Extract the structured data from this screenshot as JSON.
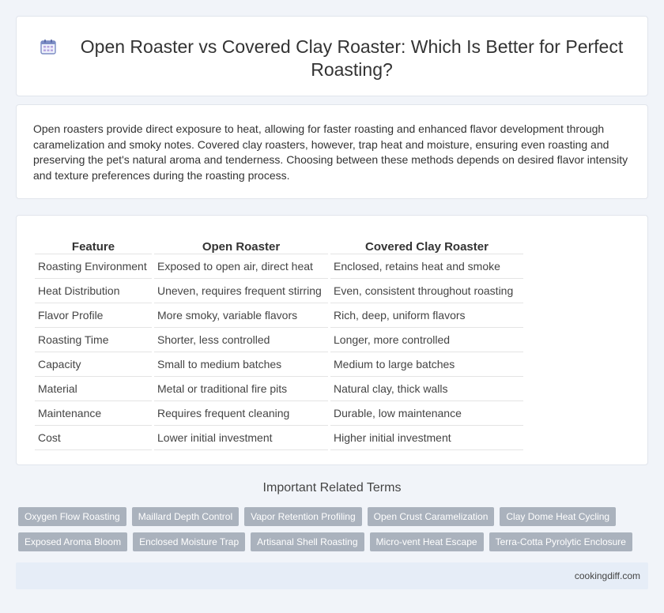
{
  "header": {
    "icon": "calendar-icon",
    "title": "Open Roaster vs Covered Clay Roaster: Which Is Better for Perfect Roasting?"
  },
  "intro": {
    "text": "Open roasters provide direct exposure to heat, allowing for faster roasting and enhanced flavor development through caramelization and smoky notes. Covered clay roasters, however, trap heat and moisture, ensuring even roasting and preserving the pet's natural aroma and tenderness. Choosing between these methods depends on desired flavor intensity and texture preferences during the roasting process."
  },
  "comparison": {
    "headers": [
      "Feature",
      "Open Roaster",
      "Covered Clay Roaster"
    ],
    "rows": [
      [
        "Roasting Environment",
        "Exposed to open air, direct heat",
        "Enclosed, retains heat and smoke"
      ],
      [
        "Heat Distribution",
        "Uneven, requires frequent stirring",
        "Even, consistent throughout roasting"
      ],
      [
        "Flavor Profile",
        "More smoky, variable flavors",
        "Rich, deep, uniform flavors"
      ],
      [
        "Roasting Time",
        "Shorter, less controlled",
        "Longer, more controlled"
      ],
      [
        "Capacity",
        "Small to medium batches",
        "Medium to large batches"
      ],
      [
        "Material",
        "Metal or traditional fire pits",
        "Natural clay, thick walls"
      ],
      [
        "Maintenance",
        "Requires frequent cleaning",
        "Durable, low maintenance"
      ],
      [
        "Cost",
        "Lower initial investment",
        "Higher initial investment"
      ]
    ]
  },
  "related": {
    "heading": "Important Related Terms",
    "tags": [
      [
        "Oxygen Flow Roasting",
        "Maillard Depth Control",
        "Vapor Retention Profiling",
        "Open Crust Caramelization",
        "Clay Dome Heat Cycling"
      ],
      [
        "Exposed Aroma Bloom",
        "Enclosed Moisture Trap",
        "Artisanal Shell Roasting",
        "Micro-vent Heat Escape",
        "Terra-Cotta Pyrolytic Enclosure"
      ]
    ]
  },
  "footer": {
    "domain": "cookingdiff.com"
  },
  "colors": {
    "background": "#f1f4f9",
    "tag": "#aab2bd",
    "footer": "#e6edf7",
    "icon_accent": "#7b8cc4"
  }
}
